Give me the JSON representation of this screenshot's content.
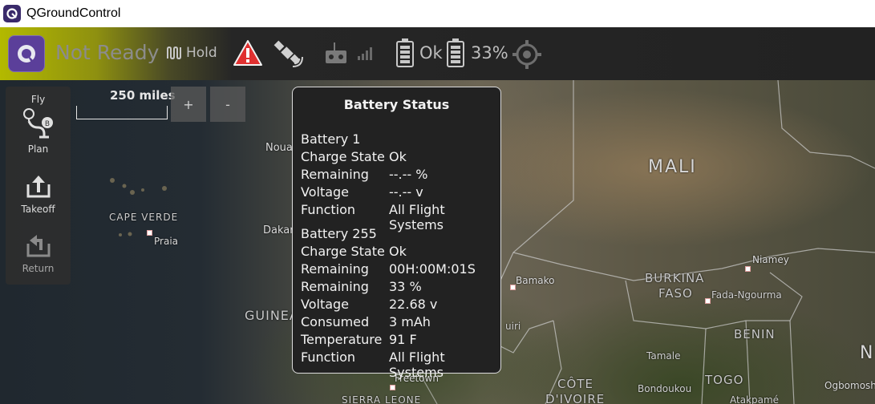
{
  "window": {
    "title": "QGroundControl"
  },
  "toolbar": {
    "status": "Not Ready",
    "flight_mode": "Hold",
    "battery1_status": "Ok",
    "battery2_percent": "33%"
  },
  "map": {
    "scale_label": "250 miles",
    "zoom_in_label": "+",
    "zoom_out_label": "-",
    "labels": {
      "mali": "MALI",
      "cape_verde": "CAPE VERDE",
      "praia": "Praia",
      "noua": "Noua",
      "dakar": "Dakar",
      "guinea": "GUINEA",
      "bamako": "Bamako",
      "burkina": "BURKINA",
      "faso": "FASO",
      "fada": "Fada-Ngourma",
      "niamey": "Niamey",
      "benin": "BENIN",
      "tamale": "Tamale",
      "togo": "TOGO",
      "cote": "CÔTE",
      "divoire": "D'IVOIRE",
      "bondoukou": "Bondoukou",
      "ogbomosho": "Ogbomosho",
      "freetown": "Freetown",
      "sierra": "SIERRA LEONE",
      "guiri": "uiri",
      "atakpame": "Atakpamé",
      "n_edge": "N"
    }
  },
  "left_toolbar": {
    "fly": "Fly",
    "plan": "Plan",
    "takeoff": "Takeoff",
    "return": "Return"
  },
  "battery_popup": {
    "title": "Battery Status",
    "battery1": {
      "heading": "Battery 1",
      "rows": [
        {
          "label": "Charge State",
          "value": "Ok"
        },
        {
          "label": "Remaining",
          "value": "--.-- %"
        },
        {
          "label": "Voltage",
          "value": "--.-- v"
        },
        {
          "label": "Function",
          "value": "All Flight Systems"
        }
      ]
    },
    "battery255": {
      "heading": "Battery 255",
      "rows": [
        {
          "label": "Charge State",
          "value": "Ok"
        },
        {
          "label": "Remaining",
          "value": "00H:00M:01S"
        },
        {
          "label": "Remaining",
          "value": "33 %"
        },
        {
          "label": "Voltage",
          "value": "22.68 v"
        },
        {
          "label": "Consumed",
          "value": "3 mAh"
        },
        {
          "label": "Temperature",
          "value": "91 F"
        },
        {
          "label": "Function",
          "value": "All Flight Systems"
        }
      ]
    }
  },
  "colors": {
    "toolbar_ready_accent": "#b3b900",
    "warning_red": "#e03030",
    "logo_purple": "#5b3f9a"
  },
  "icons": [
    "qgc-logo-icon",
    "flight-mode-icon",
    "warning-icon",
    "gps-icon",
    "rc-icon",
    "signal-icon",
    "battery-icon",
    "target-icon",
    "plan-icon",
    "takeoff-icon",
    "return-icon"
  ]
}
